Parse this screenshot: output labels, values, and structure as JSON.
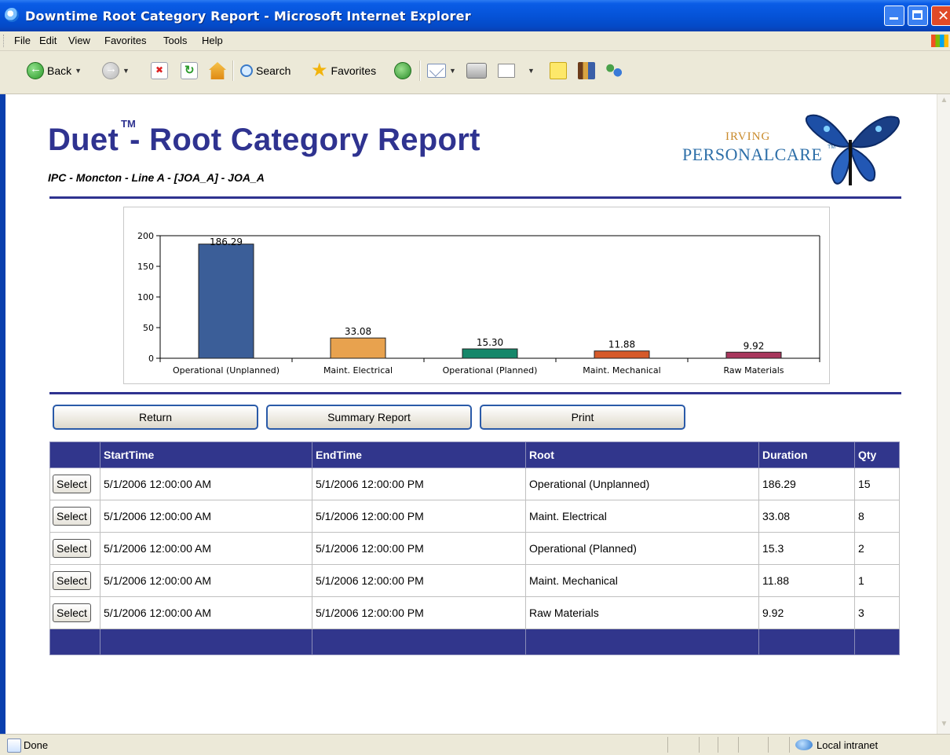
{
  "window": {
    "title": "Downtime Root Category Report - Microsoft Internet Explorer"
  },
  "menu": [
    "File",
    "Edit",
    "View",
    "Favorites",
    "Tools",
    "Help"
  ],
  "toolbar": {
    "back": "Back",
    "search": "Search",
    "favorites": "Favorites"
  },
  "page": {
    "title": "Duet",
    "title_tm": "TM",
    "title_rest": "- Root Category Report",
    "subtitle": "IPC - Moncton - Line A - [JOA_A] - JOA_A",
    "logo_line1": "IRVING",
    "logo_line2": "PERSONALCARE",
    "logo_tm": "TM"
  },
  "chart_data": {
    "type": "bar",
    "categories": [
      "Operational (Unplanned)",
      "Maint. Electrical",
      "Operational (Planned)",
      "Maint. Mechanical",
      "Raw Materials"
    ],
    "values": [
      186.29,
      33.08,
      15.3,
      11.88,
      9.92
    ],
    "value_labels": [
      "186.29",
      "33.08",
      "15.30",
      "11.88",
      "9.92"
    ],
    "colors": [
      "#3b5e98",
      "#e8a24e",
      "#15876a",
      "#d65a2a",
      "#a8365c"
    ],
    "yticks": [
      0,
      50,
      100,
      150,
      200
    ],
    "ylim": [
      0,
      200
    ],
    "title": "",
    "xlabel": "",
    "ylabel": ""
  },
  "buttons": {
    "return": "Return",
    "summary": "Summary Report",
    "print": "Print"
  },
  "table": {
    "headers": [
      "",
      "StartTime",
      "EndTime",
      "Root",
      "Duration",
      "Qty"
    ],
    "select_label": "Select",
    "rows": [
      {
        "start": "5/1/2006 12:00:00 AM",
        "end": "5/1/2006 12:00:00 PM",
        "root": "Operational (Unplanned)",
        "duration": "186.29",
        "qty": "15"
      },
      {
        "start": "5/1/2006 12:00:00 AM",
        "end": "5/1/2006 12:00:00 PM",
        "root": "Maint. Electrical",
        "duration": "33.08",
        "qty": "8"
      },
      {
        "start": "5/1/2006 12:00:00 AM",
        "end": "5/1/2006 12:00:00 PM",
        "root": "Operational (Planned)",
        "duration": "15.3",
        "qty": "2"
      },
      {
        "start": "5/1/2006 12:00:00 AM",
        "end": "5/1/2006 12:00:00 PM",
        "root": "Maint. Mechanical",
        "duration": "11.88",
        "qty": "1"
      },
      {
        "start": "5/1/2006 12:00:00 AM",
        "end": "5/1/2006 12:00:00 PM",
        "root": "Raw Materials",
        "duration": "9.92",
        "qty": "3"
      }
    ]
  },
  "status": {
    "text": "Done",
    "zone": "Local intranet"
  }
}
